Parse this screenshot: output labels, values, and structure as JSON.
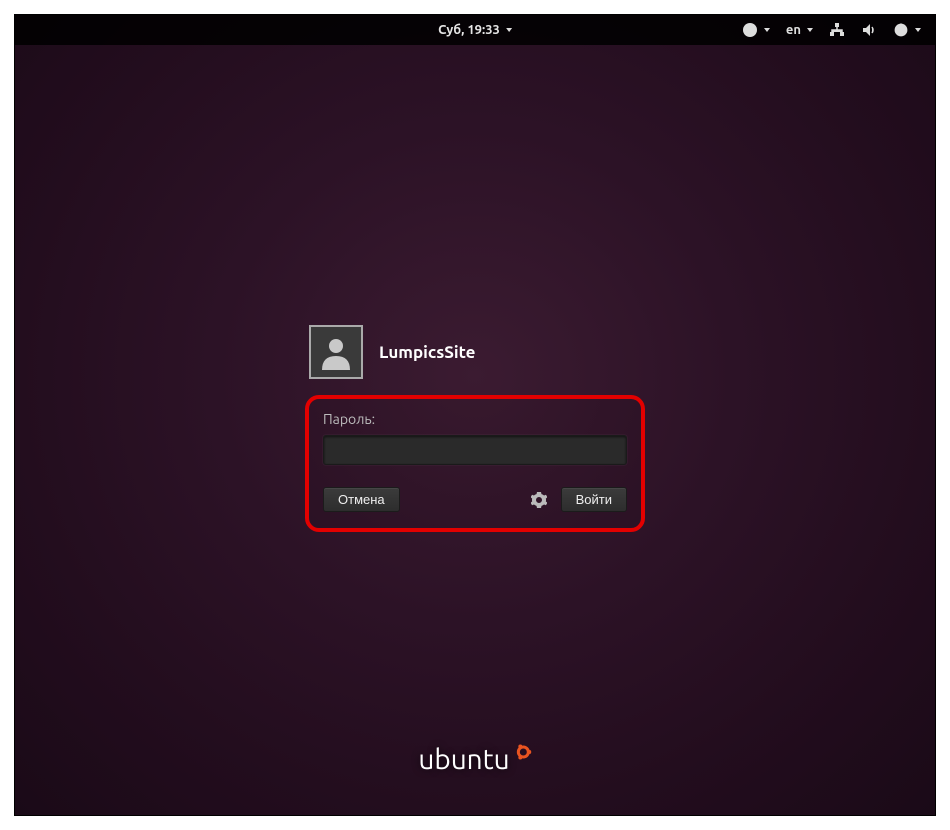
{
  "topbar": {
    "datetime": "Суб, 19:33",
    "language": "en"
  },
  "login": {
    "username": "LumpicsSite",
    "password_label": "Пароль:",
    "password_value": "",
    "cancel_label": "Отмена",
    "signin_label": "Войти"
  },
  "branding": {
    "product_name": "ubuntu"
  },
  "colors": {
    "highlight": "#e30000",
    "accent": "#E95420"
  }
}
